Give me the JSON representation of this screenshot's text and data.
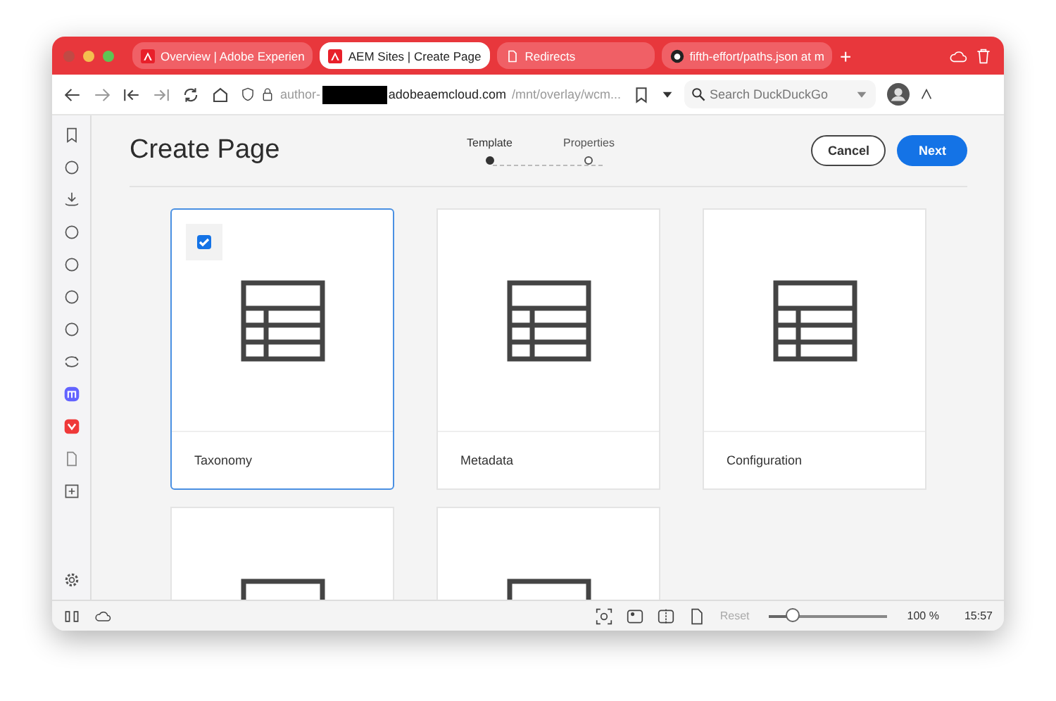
{
  "tabs": [
    {
      "title": "Overview | Adobe Experien",
      "kind": "site",
      "selected": false
    },
    {
      "title": "AEM Sites | Create Page",
      "kind": "site",
      "selected": true
    },
    {
      "title": "Redirects",
      "kind": "page",
      "selected": false
    },
    {
      "title": "fifth-effort/paths.json at m",
      "kind": "repo",
      "selected": false
    }
  ],
  "new_tab": "+",
  "address": {
    "prefix": "author-",
    "host": "adobeaemcloud.com",
    "path": "/mnt/overlay/wcm..."
  },
  "search": {
    "placeholder": "Search DuckDuckGo"
  },
  "page": {
    "title": "Create Page",
    "steps": [
      {
        "label": "Template",
        "selected": true
      },
      {
        "label": "Properties",
        "selected": false
      }
    ],
    "cancel": "Cancel",
    "next": "Next"
  },
  "cards": [
    {
      "label": "Taxonomy",
      "selected": true
    },
    {
      "label": "Metadata",
      "selected": false
    },
    {
      "label": "Configuration",
      "selected": false
    },
    {
      "selected": false
    },
    {
      "selected": false
    }
  ],
  "status_bar": {
    "reset": "Reset",
    "zoom": {
      "level": 0.2
    },
    "zoom_text": "100 %",
    "time": "15:57"
  }
}
